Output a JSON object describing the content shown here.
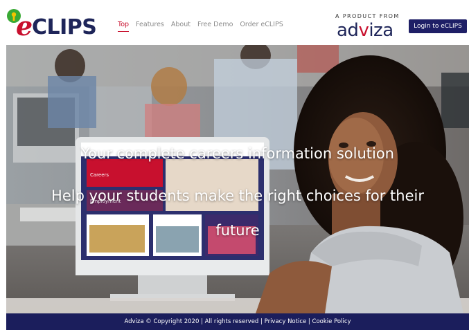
{
  "header": {
    "logo_text": "eCLIPS",
    "nav": [
      {
        "label": "Top",
        "active": true
      },
      {
        "label": "Features",
        "active": false
      },
      {
        "label": "About",
        "active": false
      },
      {
        "label": "Free Demo",
        "active": false
      },
      {
        "label": "Order eCLIPS",
        "active": false
      }
    ],
    "product_from": "A PRODUCT FROM",
    "partner_logo": {
      "part1": "ad",
      "part2": "v",
      "part3": "iza"
    },
    "login_label": "Login to eCLIPS"
  },
  "hero": {
    "title": "Your complete careers information solution",
    "subtitle": "Help your students make the right choices for their future",
    "screen_labels": [
      "Careers",
      "Employment"
    ]
  },
  "footer": {
    "copyright": "Adviza © Copyright 2020 | All rights reserved | ",
    "privacy": "Privacy Notice",
    "sep": " | ",
    "cookie": "Cookie Policy"
  },
  "colors": {
    "brand_red": "#c8102e",
    "brand_navy": "#1e1f66",
    "logo_green": "#39a935",
    "logo_yellow": "#f5c400"
  }
}
